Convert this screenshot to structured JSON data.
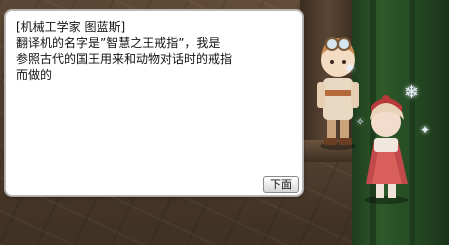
{
  "dialog": {
    "lines": [
      "[机械工学家 图蓝斯]",
      "翻译机的名字是”智慧之王戒指”，我是",
      "参照古代的国王用来和动物对话时的戒指",
      "而做的"
    ],
    "next_button_label": "下面"
  },
  "scene": {
    "banner_color": "#2e5a2a",
    "floor_color": "#4b3a2b"
  }
}
